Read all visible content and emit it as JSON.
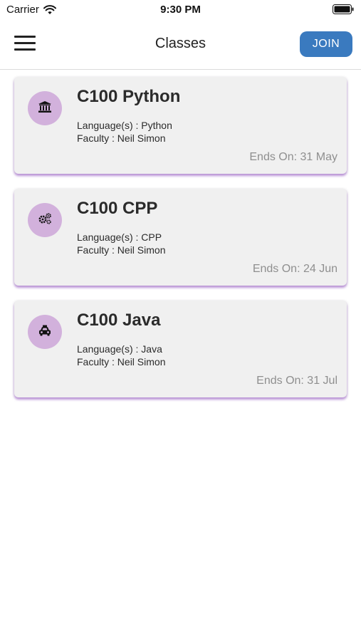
{
  "status_bar": {
    "carrier": "Carrier",
    "time": "9:30 PM"
  },
  "header": {
    "title": "Classes",
    "join_label": "JOIN"
  },
  "colors": {
    "accent_button": "#3a7abf",
    "avatar_bg": "#d2b1dc",
    "card_bg": "#f0f0f0",
    "card_shadow": "#a050c8"
  },
  "classes": [
    {
      "title": "C100 Python",
      "languages": "Language(s) : Python",
      "faculty": "Faculty : Neil Simon",
      "ends_on": "Ends On: 31 May",
      "icon": "bank-icon"
    },
    {
      "title": "C100 CPP",
      "languages": "Language(s) : CPP",
      "faculty": "Faculty : Neil Simon",
      "ends_on": "Ends On: 24 Jun",
      "icon": "gears-icon"
    },
    {
      "title": "C100 Java",
      "languages": "Language(s) : Java",
      "faculty": "Faculty : Neil Simon",
      "ends_on": "Ends On: 31 Jul",
      "icon": "taxi-icon"
    }
  ]
}
